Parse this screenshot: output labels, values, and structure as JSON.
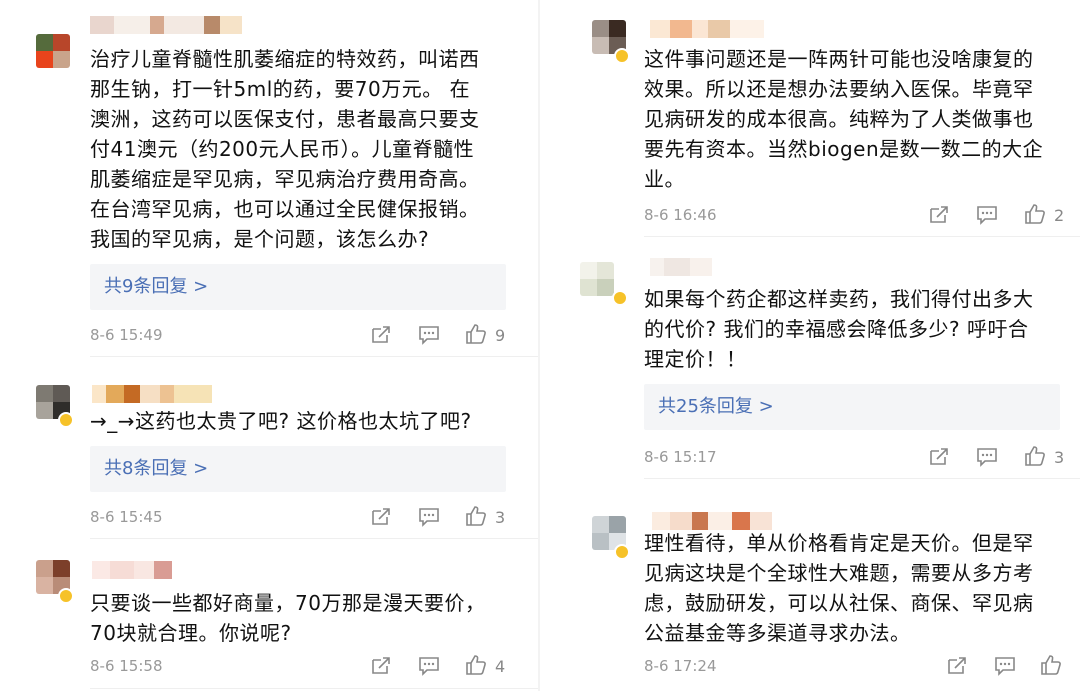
{
  "left": [
    {
      "lines": [
        "治疗儿童脊髓性肌萎缩症的特效药，叫诺西",
        "那生钠，打一针5ml的药，要70万元。 在",
        "澳洲，这药可以医保支付，患者最高只要支",
        "付41澳元（约200元人民币）。儿童脊髓性",
        "肌萎缩症是罕见病，罕见病治疗费用奇高。",
        "在台湾罕见病，也可以通过全民健保报销。",
        "我国的罕见病，是个问题，该怎么办?"
      ],
      "replies": "共9条回复 >",
      "time": "8-6 15:49",
      "likes": "9"
    },
    {
      "lines": [
        "→_→这药也太贵了吧? 这价格也太坑了吧?"
      ],
      "replies": "共8条回复 >",
      "time": "8-6 15:45",
      "likes": "3"
    },
    {
      "lines": [
        "只要谈一些都好商量，70万那是漫天要价，",
        "70块就合理。你说呢?"
      ],
      "replies": null,
      "time": "8-6 15:58",
      "likes": "4"
    }
  ],
  "right": [
    {
      "lines": [
        "这件事问题还是一阵两针可能也没啥康复的",
        "效果。所以还是想办法要纳入医保。毕竟罕",
        "见病研发的成本很高。纯粹为了人类做事也",
        "要先有资本。当然biogen是数一数二的大企",
        "业。"
      ],
      "replies": null,
      "time": "8-6 16:46",
      "likes": "2"
    },
    {
      "lines": [
        "如果每个药企都这样卖药，我们得付出多大",
        "的代价? 我们的幸福感会降低多少? 呼吁合",
        "理定价！！"
      ],
      "replies": "共25条回复 >",
      "time": "8-6 15:17",
      "likes": "3"
    },
    {
      "lines": [
        "理性看待，单从价格看肯定是天价。但是罕",
        "见病这块是个全球性大难题，需要从多方考",
        "虑，鼓励研发，可以从社保、商保、罕见病",
        "公益基金等多渠道寻求办法。"
      ],
      "replies": null,
      "time": "8-6 17:24",
      "likes": ""
    }
  ],
  "icons": {
    "share": "share-icon",
    "comment": "comment-icon",
    "like": "thumbs-up-icon"
  },
  "colors": {
    "link": "#4a6fb5",
    "meta": "#999999",
    "reply_bg": "#f4f5f7",
    "verified": "#f6c229"
  }
}
